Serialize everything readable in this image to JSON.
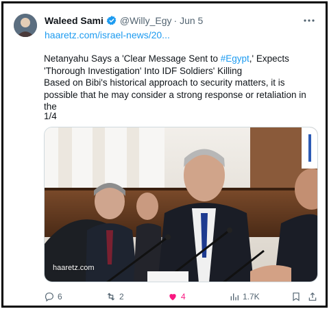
{
  "author": {
    "name": "Waleed Sami",
    "handle": "@Willy_Egy",
    "date": "· Jun 5",
    "verified_color": "#1d9bf0"
  },
  "tweet": {
    "link": "haaretz.com/israel-news/20...",
    "text_before_hashtag": "Netanyahu Says a 'Clear Message Sent to ",
    "hashtag": "#Egypt",
    "text_after_hashtag": ",' Expects 'Thorough Investigation' Into IDF Soldiers' Killing",
    "line2": "Based on Bibi's historical approach to security matters, it is possible that he may consider a strong response or retaliation in the",
    "thread_counter": "1/4",
    "media_watermark": "haaretz.com"
  },
  "actions": {
    "replies": "6",
    "retweets": "2",
    "likes": "4",
    "views": "1.7K",
    "like_color": "#f91880",
    "muted_color": "#536471"
  },
  "icons": {
    "more": "more-dots-icon",
    "verified": "verified-badge-icon",
    "reply": "reply-icon",
    "retweet": "retweet-icon",
    "like": "heart-filled-icon",
    "views": "views-bar-icon",
    "bookmark": "bookmark-icon",
    "share": "share-icon"
  }
}
